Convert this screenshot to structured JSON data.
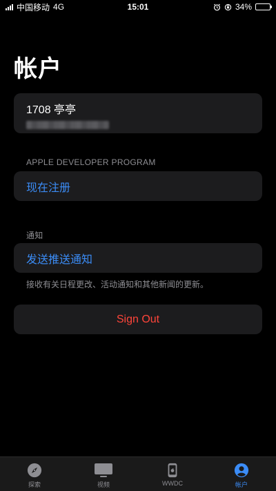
{
  "status_bar": {
    "carrier": "中国移动",
    "network": "4G",
    "time": "15:01",
    "battery": "34%",
    "battery_level": 0.34
  },
  "page": {
    "title": "帐户"
  },
  "account": {
    "name": "1708 亭亭"
  },
  "program_section": {
    "label": "APPLE DEVELOPER PROGRAM",
    "register_label": "现在注册"
  },
  "notifications": {
    "label": "通知",
    "push_label": "发送推送通知",
    "footnote": "接收有关日程更改、活动通知和其他新闻的更新。"
  },
  "sign_out": {
    "label": "Sign Out"
  },
  "tab_bar": {
    "tabs": [
      {
        "label": "探索",
        "icon": "compass-icon"
      },
      {
        "label": "视频",
        "icon": "tv-icon"
      },
      {
        "label": "WWDC",
        "icon": "phone-apple-icon"
      },
      {
        "label": "帐户",
        "icon": "account-icon",
        "active": true
      }
    ]
  },
  "colors": {
    "background": "#000000",
    "card": "#1c1c1e",
    "accent": "#3b8cf6",
    "destructive": "#ff453a",
    "secondary_text": "#8e8e93"
  }
}
